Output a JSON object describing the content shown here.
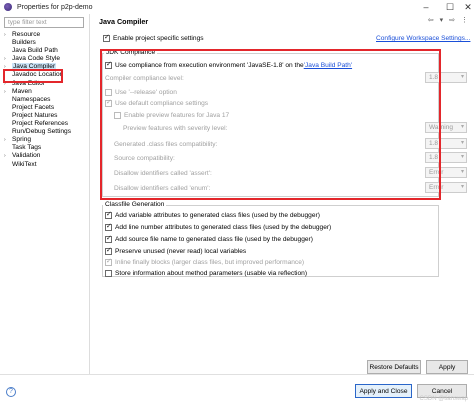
{
  "window": {
    "title": "Properties for p2p-demo"
  },
  "filter": {
    "placeholder": "type filter text"
  },
  "tree": [
    {
      "label": "Resource",
      "arrow": "›"
    },
    {
      "label": "Builders",
      "arrow": ""
    },
    {
      "label": "Java Build Path",
      "arrow": ""
    },
    {
      "label": "Java Code Style",
      "arrow": "›"
    },
    {
      "label": "Java Compiler",
      "arrow": "›"
    },
    {
      "label": "Javadoc Location",
      "arrow": ""
    },
    {
      "label": "Java Editor",
      "arrow": "›"
    },
    {
      "label": "Maven",
      "arrow": "›"
    },
    {
      "label": "Namespaces",
      "arrow": ""
    },
    {
      "label": "Project Facets",
      "arrow": ""
    },
    {
      "label": "Project Natures",
      "arrow": ""
    },
    {
      "label": "Project References",
      "arrow": ""
    },
    {
      "label": "Run/Debug Settings",
      "arrow": ""
    },
    {
      "label": "Spring",
      "arrow": "›"
    },
    {
      "label": "Task Tags",
      "arrow": ""
    },
    {
      "label": "Validation",
      "arrow": "›"
    },
    {
      "label": "WikiText",
      "arrow": ""
    }
  ],
  "page": {
    "title": "Java Compiler",
    "enable_specific": "Enable project specific settings",
    "configure_link": "Configure Workspace Settings..."
  },
  "jdk": {
    "group_label": "JDK Compliance",
    "use_env_prefix": "Use compliance from execution environment 'JavaSE-1.8' on the ",
    "use_env_link": "'Java Build Path'",
    "compliance_level_label": "Compiler compliance level:",
    "compliance_level_value": "1.8",
    "release_option": "Use '--release' option",
    "default_settings": "Use default compliance settings",
    "preview_features": "Enable preview features for Java 17",
    "preview_severity_label": "Preview features with severity level:",
    "preview_severity_value": "Warning",
    "generated_compat_label": "Generated .class files compatibility:",
    "generated_compat_value": "1.8",
    "source_compat_label": "Source compatibility:",
    "source_compat_value": "1.8",
    "assert_label": "Disallow identifiers called 'assert':",
    "assert_value": "Error",
    "enum_label": "Disallow identifiers called 'enum':",
    "enum_value": "Error"
  },
  "classfile": {
    "group_label": "Classfile Generation",
    "items": [
      "Add variable attributes to generated class files (used by the debugger)",
      "Add line number attributes to generated class files (used by the debugger)",
      "Add source file name to generated class file (used by the debugger)",
      "Preserve unused (never read) local variables",
      "Inline finally blocks (larger class files, but improved performance)",
      "Store information about method parameters (usable via reflection)"
    ]
  },
  "buttons": {
    "restore": "Restore Defaults",
    "apply": "Apply",
    "apply_close": "Apply and Close",
    "cancel": "Cancel"
  },
  "watermark": "CSDN @tianswap",
  "colors": {
    "highlight_border": "#e3262b",
    "link": "#1a4fd8",
    "selection": "#cce4f7"
  }
}
